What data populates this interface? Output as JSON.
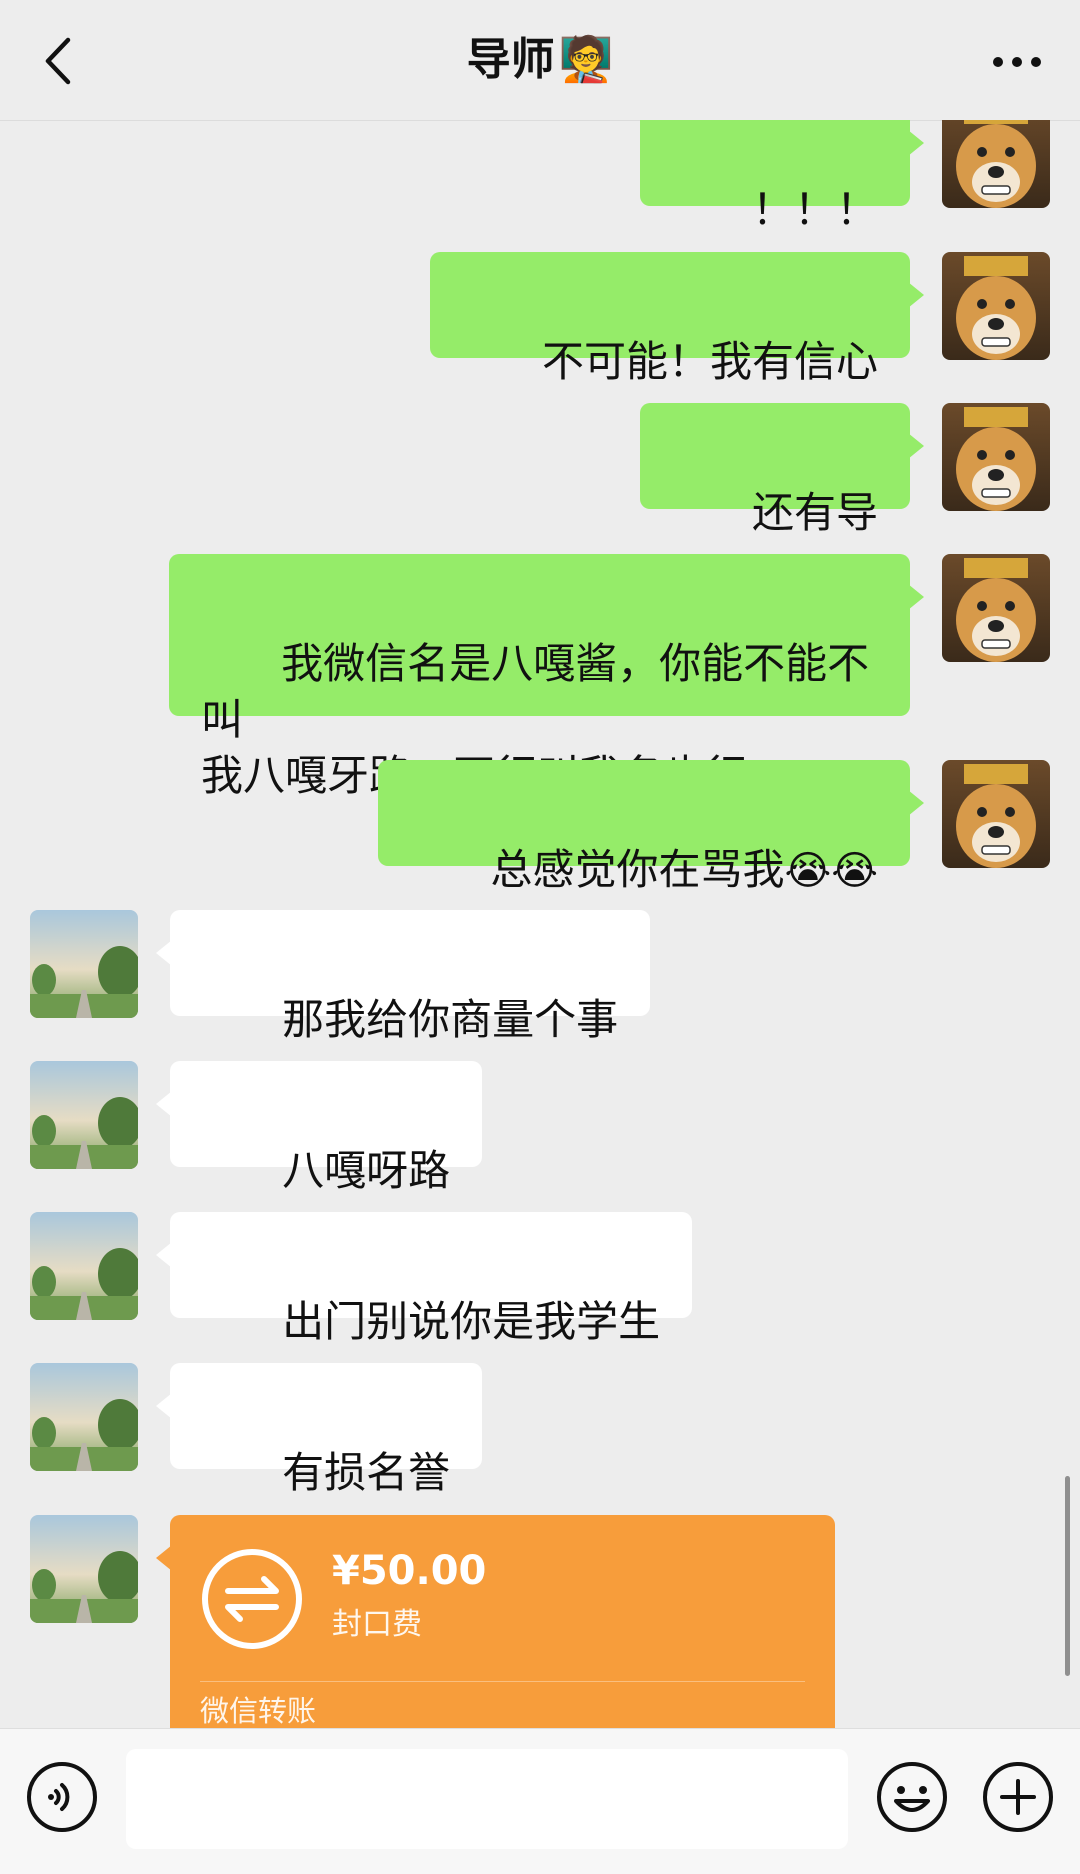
{
  "header": {
    "title": "导师",
    "title_emoji": "🧑‍🏫",
    "back_icon": "chevron-left-icon",
    "more_icon": "more-dots-icon"
  },
  "messages": [
    {
      "sender": "me",
      "text": "！！！"
    },
    {
      "sender": "me",
      "text": "不可能！我有信心"
    },
    {
      "sender": "me",
      "text": "还有导"
    },
    {
      "sender": "me",
      "text": "我微信名是八嘎酱，你能不能不叫\n我八嘎牙路，不行叫我名也行"
    },
    {
      "sender": "me",
      "text": "总感觉你在骂我",
      "emoji": "😭😭"
    },
    {
      "sender": "peer",
      "text": "那我给你商量个事"
    },
    {
      "sender": "peer",
      "text": "八嘎呀路"
    },
    {
      "sender": "peer",
      "text": "出门别说你是我学生"
    },
    {
      "sender": "peer",
      "text": "有损名誉"
    }
  ],
  "transfer": {
    "amount": "¥50.00",
    "note": "封口费",
    "label": "微信转账",
    "icon": "transfer-arrows-icon"
  },
  "input_bar": {
    "placeholder": "",
    "voice_icon": "voice-icon",
    "emoji_icon": "smiley-icon",
    "plus_icon": "plus-icon"
  },
  "colors": {
    "background": "#ededed",
    "my_bubble": "#95ec69",
    "peer_bubble": "#ffffff",
    "transfer_card": "#f79d3b"
  }
}
